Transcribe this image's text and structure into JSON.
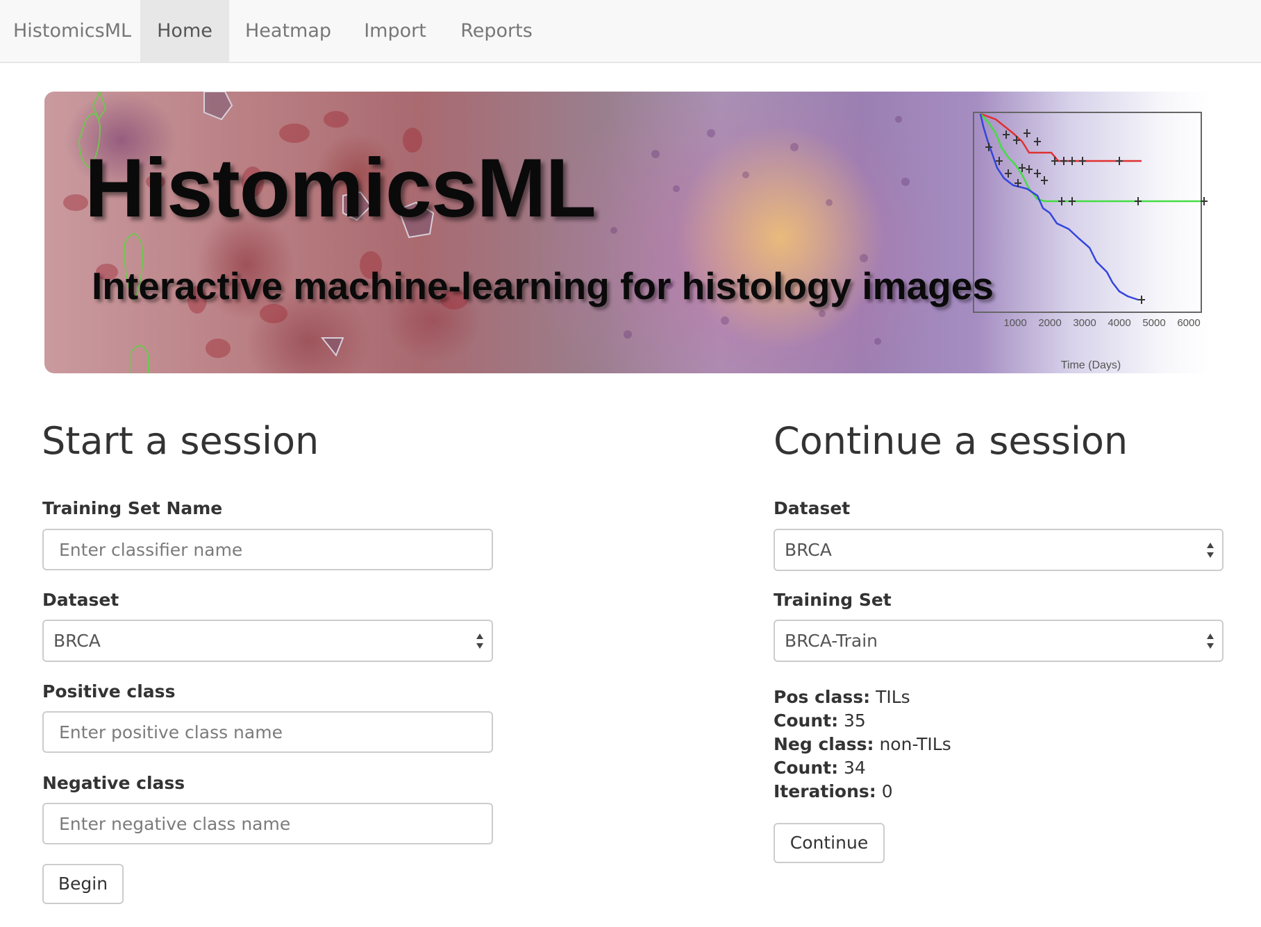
{
  "navbar": {
    "brand": "HistomicsML",
    "tabs": [
      {
        "label": "Home",
        "active": true
      },
      {
        "label": "Heatmap",
        "active": false
      },
      {
        "label": "Import",
        "active": false
      },
      {
        "label": "Reports",
        "active": false
      }
    ]
  },
  "banner": {
    "title": "HistomicsML",
    "subtitle": "Interactive machine-learning for histology images",
    "chart": {
      "x_ticks": [
        "1000",
        "2000",
        "3000",
        "4000",
        "5000",
        "6000"
      ],
      "x_label": "Time (Days)",
      "series_colors": [
        "#e03030",
        "#44dd44",
        "#3344dd",
        "#333333"
      ]
    }
  },
  "start_session": {
    "heading": "Start a session",
    "training_set_name_label": "Training Set Name",
    "training_set_name_placeholder": "Enter classifier name",
    "dataset_label": "Dataset",
    "dataset_value": "BRCA",
    "positive_class_label": "Positive class",
    "positive_class_placeholder": "Enter positive class name",
    "negative_class_label": "Negative class",
    "negative_class_placeholder": "Enter negative class name",
    "begin_label": "Begin"
  },
  "continue_session": {
    "heading": "Continue a session",
    "dataset_label": "Dataset",
    "dataset_value": "BRCA",
    "training_set_label": "Training Set",
    "training_set_value": "BRCA-Train",
    "pos_class_label": "Pos class:",
    "pos_class_value": "TILs",
    "pos_count_label": "Count:",
    "pos_count_value": "35",
    "neg_class_label": "Neg class:",
    "neg_class_value": "non-TILs",
    "neg_count_label": "Count:",
    "neg_count_value": "34",
    "iterations_label": "Iterations:",
    "iterations_value": "0",
    "continue_label": "Continue"
  }
}
